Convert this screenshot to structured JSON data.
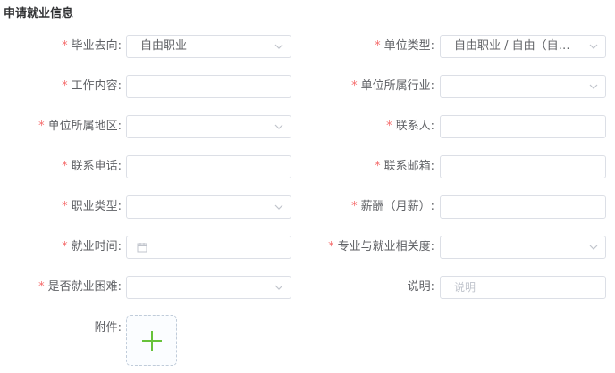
{
  "section_title": "申请就业信息",
  "required_mark": "*",
  "fields": {
    "graduation_destination": {
      "label": "毕业去向:",
      "value": "自由职业"
    },
    "employer_type": {
      "label": "单位类型:",
      "value": "自由职业 / 自由（自由职业）"
    },
    "job_content": {
      "label": "工作内容:",
      "value": ""
    },
    "employer_industry": {
      "label": "单位所属行业:",
      "value": ""
    },
    "employer_region": {
      "label": "单位所属地区:",
      "value": ""
    },
    "contact_person": {
      "label": "联系人:",
      "value": ""
    },
    "contact_phone": {
      "label": "联系电话:",
      "value": ""
    },
    "contact_email": {
      "label": "联系邮箱:",
      "value": ""
    },
    "occupation_type": {
      "label": "职业类型:",
      "value": ""
    },
    "salary": {
      "label": "薪酬（月薪）:",
      "value": ""
    },
    "employment_time": {
      "label": "就业时间:",
      "value": ""
    },
    "major_relevance": {
      "label": "专业与就业相关度:",
      "value": ""
    },
    "employment_difficulty": {
      "label": "是否就业困难:",
      "value": ""
    },
    "remarks": {
      "label": "说明:",
      "placeholder": "说明"
    },
    "attachment": {
      "label": "附件:"
    }
  },
  "colors": {
    "required": "#f56c6c",
    "upload_plus": "#67c23a",
    "border": "#dcdfe6"
  },
  "icons": {
    "select_arrow": "chevron-down-icon",
    "date": "calendar-icon",
    "upload": "plus-icon"
  }
}
